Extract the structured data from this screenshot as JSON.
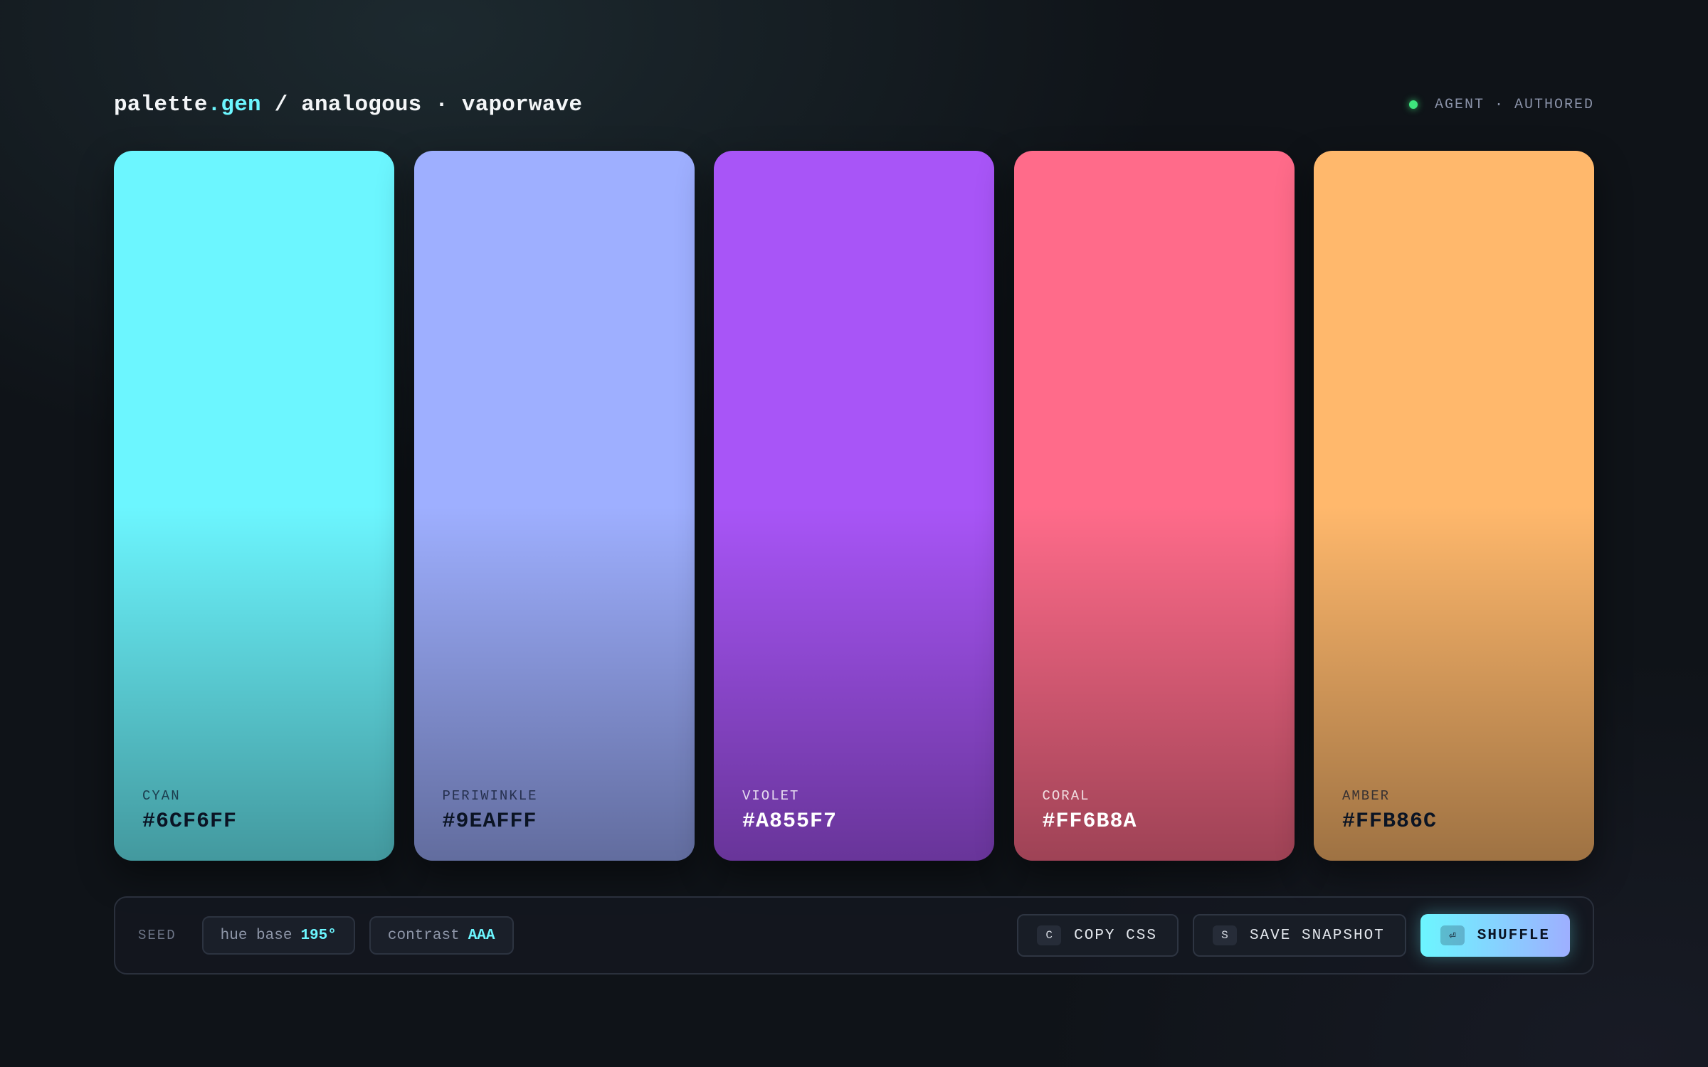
{
  "header": {
    "title_brand": "palette",
    "title_accent": ".gen",
    "title_rest": " / analogous · vaporwave",
    "status_label": "AGENT · AUTHORED",
    "status_color": "#3ee57d"
  },
  "swatches": [
    {
      "name": "CYAN",
      "hex": "#6CF6FF",
      "color": "#6cf6ff"
    },
    {
      "name": "PERIWINKLE",
      "hex": "#9EAFFF",
      "color": "#9eafff"
    },
    {
      "name": "VIOLET",
      "hex": "#A855F7",
      "color": "#a855f7"
    },
    {
      "name": "CORAL",
      "hex": "#FF6B8A",
      "color": "#ff6b8a"
    },
    {
      "name": "AMBER",
      "hex": "#FFB86C",
      "color": "#ffb86c"
    }
  ],
  "controls": {
    "seed_label": "SEED",
    "hue_label": "hue base",
    "hue_value": "195°",
    "contrast_label": "contrast",
    "contrast_value": "AAA",
    "copy_key": "C",
    "copy_label": "COPY CSS",
    "save_key": "S",
    "save_label": "SAVE SNAPSHOT",
    "shuffle_key": "⏎",
    "shuffle_label": "SHUFFLE"
  }
}
